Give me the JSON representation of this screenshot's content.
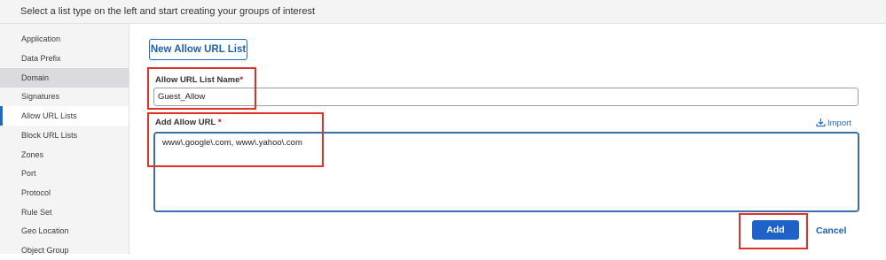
{
  "header": {
    "instruction": "Select a list type on the left and start creating your groups of interest"
  },
  "sidebar": {
    "items": [
      {
        "label": "Application"
      },
      {
        "label": "Data Prefix"
      },
      {
        "label": "Domain"
      },
      {
        "label": "Signatures"
      },
      {
        "label": "Allow URL Lists"
      },
      {
        "label": "Block URL Lists"
      },
      {
        "label": "Zones"
      },
      {
        "label": "Port"
      },
      {
        "label": "Protocol"
      },
      {
        "label": "Rule Set"
      },
      {
        "label": "Geo Location"
      },
      {
        "label": "Object Group"
      }
    ],
    "selected": "Allow URL Lists",
    "highlighted": "Domain"
  },
  "main": {
    "new_list_button": "New Allow URL List",
    "list_name": {
      "label": "Allow URL List Name",
      "required_mark": "*",
      "value": "Guest_Allow"
    },
    "allow_url": {
      "label": "Add Allow URL",
      "required_mark": "*",
      "value": "www\\.google\\.com, www\\.yahoo\\.com"
    },
    "import_label": "Import",
    "add_button": "Add",
    "cancel_button": "Cancel"
  },
  "colors": {
    "accent": "#1e6bc4",
    "annotation": "#e03127",
    "required": "#d0021b"
  }
}
